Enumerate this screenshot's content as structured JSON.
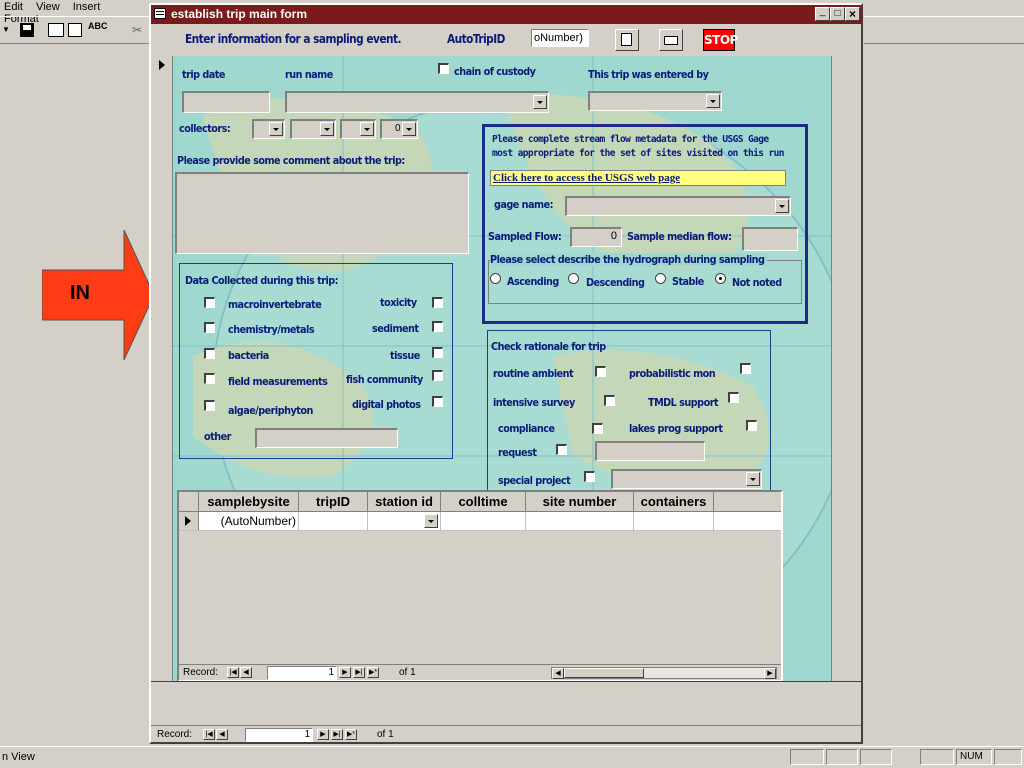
{
  "app": {
    "menu": [
      "Edit",
      "View",
      "Insert",
      "Format"
    ],
    "status_left": "n View",
    "status_num": "NUM"
  },
  "window": {
    "title": "establish trip main form",
    "min": "_",
    "max": "□",
    "close": "×"
  },
  "header": {
    "instruction": "Enter information for a sampling event.",
    "autotrip_label": "AutoTripID",
    "autotrip_value": "oNumber)",
    "stop_label": "STOP"
  },
  "arrow": {
    "label": "IN",
    "color": "#ff3c14"
  },
  "trip": {
    "trip_date_label": "trip date",
    "run_name_label": "run name",
    "chain_of_custody_label": "chain of custody",
    "entered_by_label": "This trip was entered by",
    "collectors_label": "collectors:",
    "collector4_value": "0",
    "comment_label": "Please provide some comment about the trip:"
  },
  "data_collected": {
    "title": "Data Collected during this trip:",
    "left": [
      "macroinvertebrate",
      "chemistry/metals",
      "bacteria",
      "field measurements",
      "algae/periphyton"
    ],
    "right": [
      "toxicity",
      "sediment",
      "tissue",
      "fish community",
      "digital photos"
    ],
    "other_label": "other"
  },
  "usgs": {
    "line1": "Please complete stream flow metadata for the USGS Gage",
    "line2": "most appropriate for the set of sites visited on this run",
    "link": "Click here to access the USGS web page",
    "gage_name_label": "gage name:",
    "sampled_flow_label": "Sampled Flow:",
    "sampled_flow_value": "0",
    "median_flow_label": "Sample median flow:",
    "hydro_label": "Please select describe the hydrograph during sampling",
    "options": [
      "Ascending",
      "Descending",
      "Stable",
      "Not noted"
    ],
    "selected": "Not noted"
  },
  "rationale": {
    "title": "Check rationale for trip",
    "left": [
      "routine ambient",
      "intensive survey",
      "compliance"
    ],
    "right": [
      "probabilistic mon",
      "TMDL support",
      "lakes prog support"
    ],
    "request_label": "request",
    "special_label": "special project"
  },
  "subform": {
    "columns": [
      "samplebysite",
      "tripID",
      "station id",
      "colltime",
      "site number",
      "containers"
    ],
    "row": [
      "(AutoNumber)",
      "",
      "",
      "",
      "",
      ""
    ],
    "record_label": "Record:",
    "record_value": "1",
    "of_label": "of 1"
  },
  "main_record": {
    "record_label": "Record:",
    "record_value": "1",
    "of_label": "of 1"
  },
  "colors": {
    "titlebar": "#7b1a1a",
    "form_bg": "#9fd8cf",
    "navy_text": "#0a1a7a",
    "stop_red": "#ff0000"
  }
}
